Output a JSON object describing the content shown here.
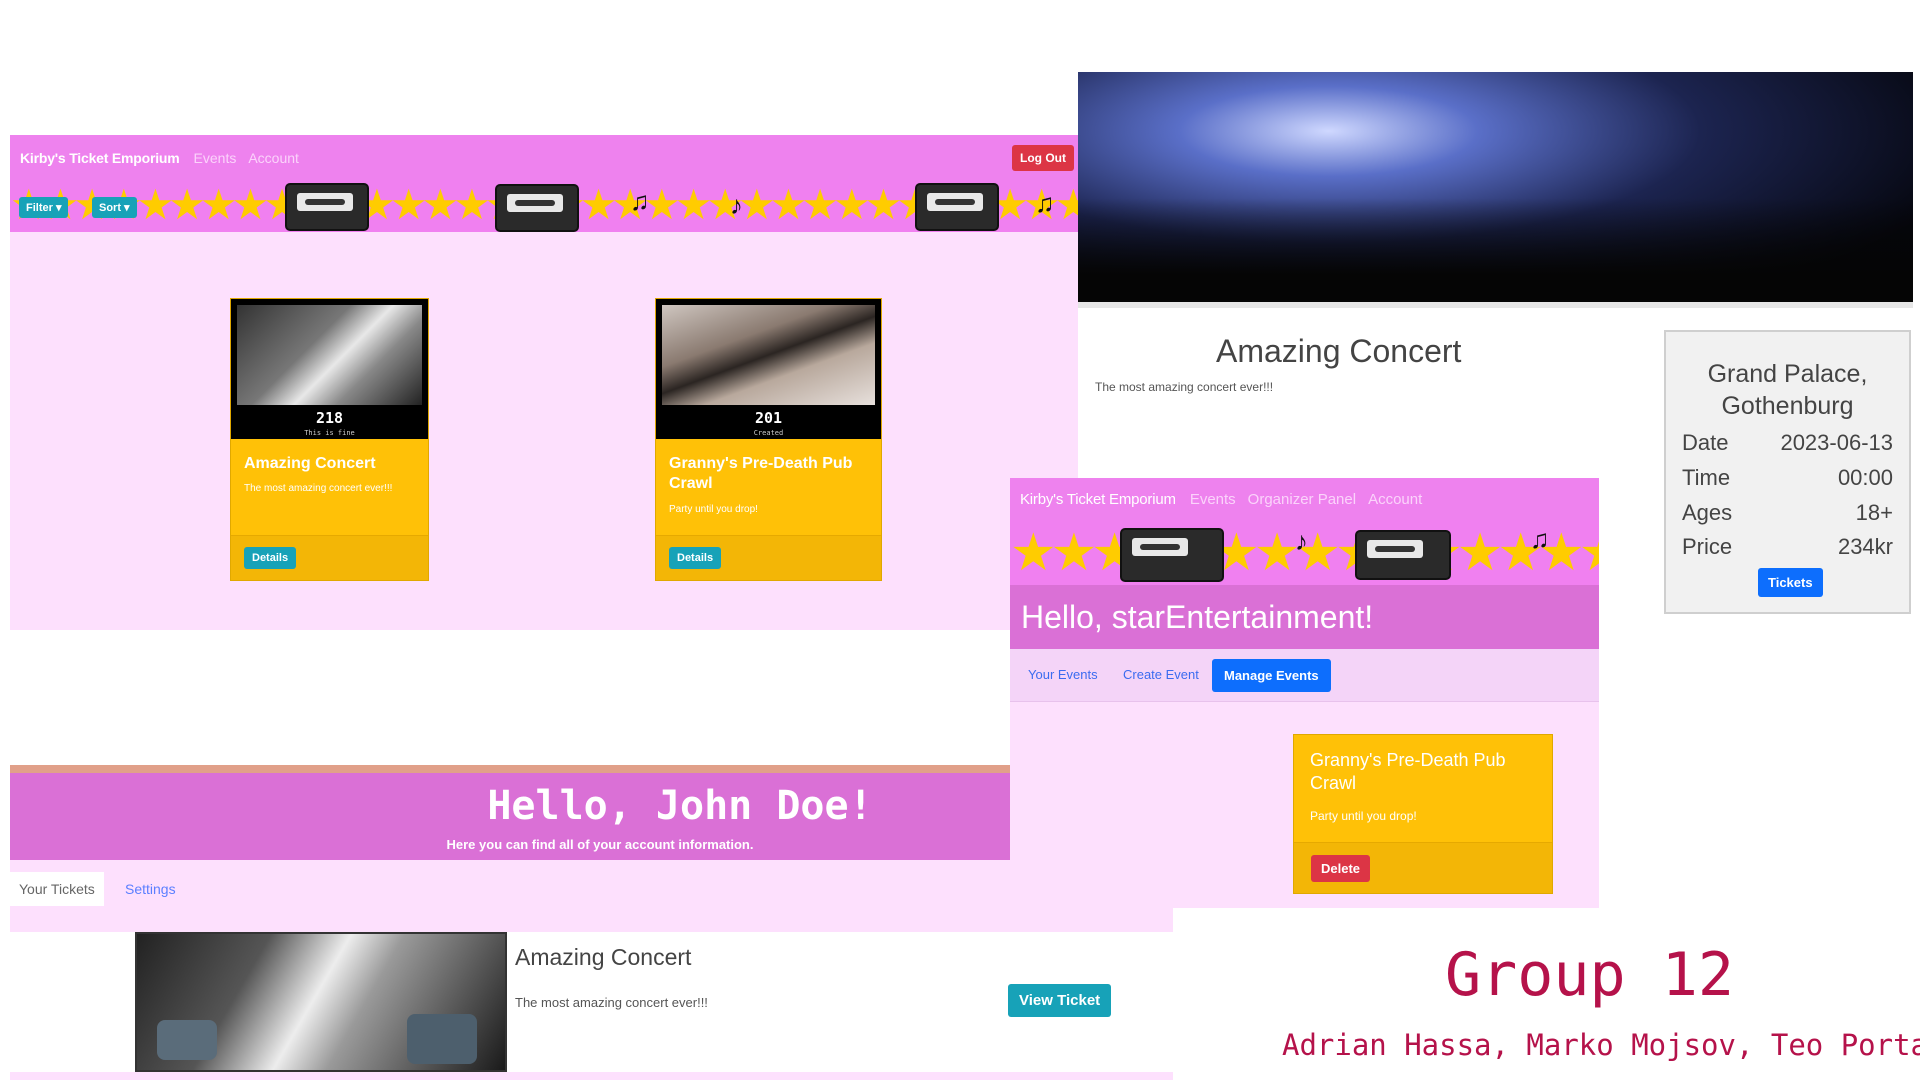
{
  "events_page": {
    "brand": "Kirby's Ticket Emporium",
    "nav": [
      "Events",
      "Account"
    ],
    "logout_label": "Log Out",
    "filter_label": "Filter",
    "sort_label": "Sort",
    "events": [
      {
        "number": "218",
        "caption": "This is fine",
        "title": "Amazing Concert",
        "description": "The most amazing concert ever!!!",
        "button": "Details"
      },
      {
        "number": "201",
        "caption": "Created",
        "title": "Granny's Pre-Death Pub Crawl",
        "description": "Party until you drop!",
        "button": "Details"
      }
    ]
  },
  "account_page": {
    "greeting": "Hello, John Doe!",
    "subtitle": "Here you can find all of your account information.",
    "tabs": [
      "Your Tickets",
      "Settings"
    ],
    "ticket": {
      "title": "Amazing Concert",
      "description": "The most amazing concert ever!!!",
      "button": "View Ticket"
    }
  },
  "event_detail": {
    "title": "Amazing Concert",
    "description": "The most amazing concert ever!!!",
    "venue": "Grand Palace, Gothenburg",
    "rows": [
      {
        "label": "Date",
        "value": "2023-06-13"
      },
      {
        "label": "Time",
        "value": "00:00"
      },
      {
        "label": "Ages",
        "value": "18+"
      },
      {
        "label": "Price",
        "value": "234kr"
      }
    ],
    "tickets_button": "Tickets"
  },
  "organizer_page": {
    "brand": "Kirby's Ticket Emporium",
    "nav": [
      "Events",
      "Organizer Panel",
      "Account"
    ],
    "greeting": "Hello, starEntertainment!",
    "tabs": [
      "Your Events",
      "Create Event",
      "Manage Events"
    ],
    "event": {
      "title": "Granny's Pre-Death Pub Crawl",
      "description": "Party until you drop!",
      "button": "Delete"
    }
  },
  "credits": {
    "group": "Group 12",
    "authors": "Adrian Hassa, Marko Mojsov, Teo Portase"
  },
  "colors": {
    "navbar": "#ee82ee",
    "page_bg": "#fde0fd",
    "card": "#ffc107",
    "teal_button": "#17a2b8",
    "primary_button": "#0d6efd",
    "danger_button": "#dc3545",
    "credits_text": "#b5124a"
  }
}
